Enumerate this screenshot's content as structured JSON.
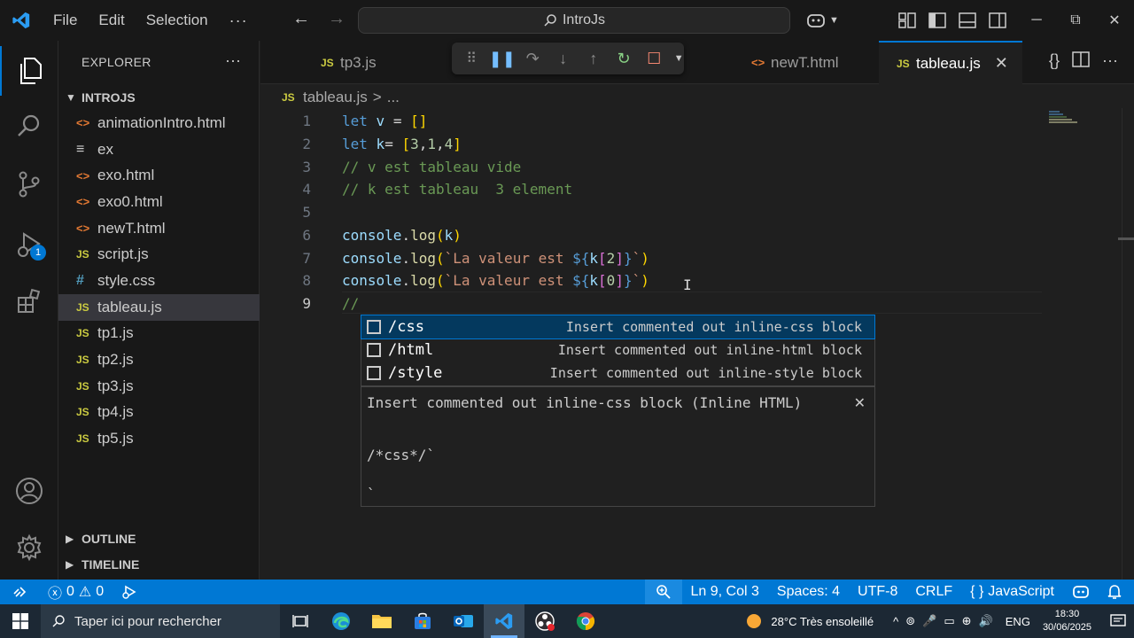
{
  "titlebar": {
    "menu": [
      "File",
      "Edit",
      "Selection"
    ],
    "more": "···",
    "back": "←",
    "forward": "→",
    "search_text": "IntroJs",
    "win_min": "─",
    "win_restore": "⧉",
    "win_close": "✕"
  },
  "activity": {
    "run_badge": "1"
  },
  "explorer": {
    "title": "EXPLORER",
    "more": "···",
    "folder": "INTROJS",
    "files": [
      {
        "name": "animationIntro.html",
        "type": "html",
        "icon": "<>"
      },
      {
        "name": "ex",
        "type": "txt",
        "icon": "≡"
      },
      {
        "name": "exo.html",
        "type": "html",
        "icon": "<>"
      },
      {
        "name": "exo0.html",
        "type": "html",
        "icon": "<>"
      },
      {
        "name": "newT.html",
        "type": "html",
        "icon": "<>"
      },
      {
        "name": "script.js",
        "type": "js",
        "icon": "JS"
      },
      {
        "name": "style.css",
        "type": "css",
        "icon": "#"
      },
      {
        "name": "tableau.js",
        "type": "js",
        "icon": "JS",
        "selected": true
      },
      {
        "name": "tp1.js",
        "type": "js",
        "icon": "JS"
      },
      {
        "name": "tp2.js",
        "type": "js",
        "icon": "JS"
      },
      {
        "name": "tp3.js",
        "type": "js",
        "icon": "JS"
      },
      {
        "name": "tp4.js",
        "type": "js",
        "icon": "JS"
      },
      {
        "name": "tp5.js",
        "type": "js",
        "icon": "JS"
      }
    ],
    "outline": "OUTLINE",
    "timeline": "TIMELINE"
  },
  "tabs": {
    "tab1": {
      "icon": "JS",
      "label": "tp3.js"
    },
    "tab2": {
      "icon": "<>",
      "label": "newT.html"
    },
    "tab3": {
      "icon": "JS",
      "label": "tableau.js",
      "close": "✕"
    }
  },
  "breadcrumb": {
    "icon": "JS",
    "file": "tableau.js",
    "sep": ">",
    "rest": "..."
  },
  "editor": {
    "line_numbers": [
      "1",
      "2",
      "3",
      "4",
      "5",
      "6",
      "7",
      "8",
      "9"
    ],
    "current_line": 9
  },
  "suggest": {
    "items": [
      {
        "label": "/css",
        "detail": "Insert commented out inline-css block"
      },
      {
        "label": "/html",
        "detail": "Insert commented out inline-html block"
      },
      {
        "label": "/style",
        "detail": "Insert commented out inline-style block"
      }
    ],
    "doc_title": "Insert commented out inline-css block (Inline HTML)",
    "doc_close": "✕",
    "doc_code_1": "/*css*/`",
    "doc_code_2": "`"
  },
  "statusbar": {
    "errors": "0",
    "warnings": "0",
    "position": "Ln 9, Col 3",
    "spaces": "Spaces: 4",
    "encoding": "UTF-8",
    "eol": "CRLF",
    "language_icon": "{ }",
    "language": "JavaScript"
  },
  "taskbar": {
    "search_placeholder": "Taper ici pour rechercher",
    "weather": "28°C  Très ensoleillé",
    "lang": "ENG",
    "time": "18:30",
    "date": "30/06/2025"
  },
  "colors": {
    "accent": "#0078d4",
    "keyword": "#569cd6",
    "comment": "#6a9955",
    "string": "#ce9178"
  }
}
